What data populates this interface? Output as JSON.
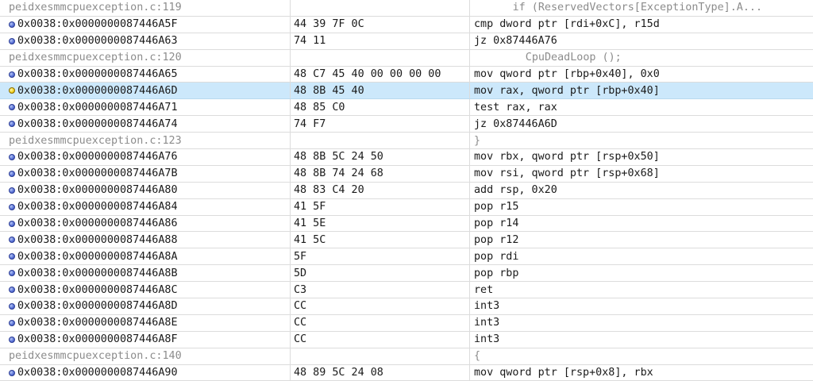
{
  "rows": [
    {
      "type": "source",
      "file": "peidxesmmcpuexception.c:119",
      "code": "if (ReservedVectors[ExceptionType].A..."
    },
    {
      "type": "asm",
      "addr": "0x0038:0x0000000087446A5F",
      "bytes": "44 39 7F 0C",
      "instr": "cmp dword ptr [rdi+0xC], r15d"
    },
    {
      "type": "asm",
      "addr": "0x0038:0x0000000087446A63",
      "bytes": "74 11",
      "instr": "jz 0x87446A76"
    },
    {
      "type": "source",
      "file": "peidxesmmcpuexception.c:120",
      "code": "CpuDeadLoop ();"
    },
    {
      "type": "asm",
      "addr": "0x0038:0x0000000087446A65",
      "bytes": "48 C7 45 40 00 00 00 00",
      "instr": "mov qword ptr [rbp+0x40], 0x0"
    },
    {
      "type": "asm",
      "addr": "0x0038:0x0000000087446A6D",
      "bytes": "48 8B 45 40",
      "instr": "mov rax, qword ptr [rbp+0x40]",
      "current": true
    },
    {
      "type": "asm",
      "addr": "0x0038:0x0000000087446A71",
      "bytes": "48 85 C0",
      "instr": "test rax, rax"
    },
    {
      "type": "asm",
      "addr": "0x0038:0x0000000087446A74",
      "bytes": "74 F7",
      "instr": "jz 0x87446A6D"
    },
    {
      "type": "source",
      "file": "peidxesmmcpuexception.c:123",
      "code": "}"
    },
    {
      "type": "asm",
      "addr": "0x0038:0x0000000087446A76",
      "bytes": "48 8B 5C 24 50",
      "instr": "mov rbx, qword ptr [rsp+0x50]"
    },
    {
      "type": "asm",
      "addr": "0x0038:0x0000000087446A7B",
      "bytes": "48 8B 74 24 68",
      "instr": "mov rsi, qword ptr [rsp+0x68]"
    },
    {
      "type": "asm",
      "addr": "0x0038:0x0000000087446A80",
      "bytes": "48 83 C4 20",
      "instr": "add rsp, 0x20"
    },
    {
      "type": "asm",
      "addr": "0x0038:0x0000000087446A84",
      "bytes": "41 5F",
      "instr": "pop r15"
    },
    {
      "type": "asm",
      "addr": "0x0038:0x0000000087446A86",
      "bytes": "41 5E",
      "instr": "pop r14"
    },
    {
      "type": "asm",
      "addr": "0x0038:0x0000000087446A88",
      "bytes": "41 5C",
      "instr": "pop r12"
    },
    {
      "type": "asm",
      "addr": "0x0038:0x0000000087446A8A",
      "bytes": "5F",
      "instr": "pop rdi"
    },
    {
      "type": "asm",
      "addr": "0x0038:0x0000000087446A8B",
      "bytes": "5D",
      "instr": "pop rbp"
    },
    {
      "type": "asm",
      "addr": "0x0038:0x0000000087446A8C",
      "bytes": "C3",
      "instr": "ret"
    },
    {
      "type": "asm",
      "addr": "0x0038:0x0000000087446A8D",
      "bytes": "CC",
      "instr": "int3"
    },
    {
      "type": "asm",
      "addr": "0x0038:0x0000000087446A8E",
      "bytes": "CC",
      "instr": "int3"
    },
    {
      "type": "asm",
      "addr": "0x0038:0x0000000087446A8F",
      "bytes": "CC",
      "instr": "int3"
    },
    {
      "type": "source",
      "file": "peidxesmmcpuexception.c:140",
      "code": "{"
    },
    {
      "type": "asm",
      "addr": "0x0038:0x0000000087446A90",
      "bytes": "48 89 5C 24 08",
      "instr": "mov qword ptr [rsp+0x8], rbx"
    }
  ],
  "source_indent": {
    "peidxesmmcpuexception.c:119": 6,
    "peidxesmmcpuexception.c:120": 8,
    "peidxesmmcpuexception.c:123": 0,
    "peidxesmmcpuexception.c:140": 0
  },
  "colors": {
    "selected_row": "#cce8fb",
    "source_text": "#8c8c8c",
    "breakpoint": "#5a73d8",
    "current_marker": "#f2d11a"
  }
}
